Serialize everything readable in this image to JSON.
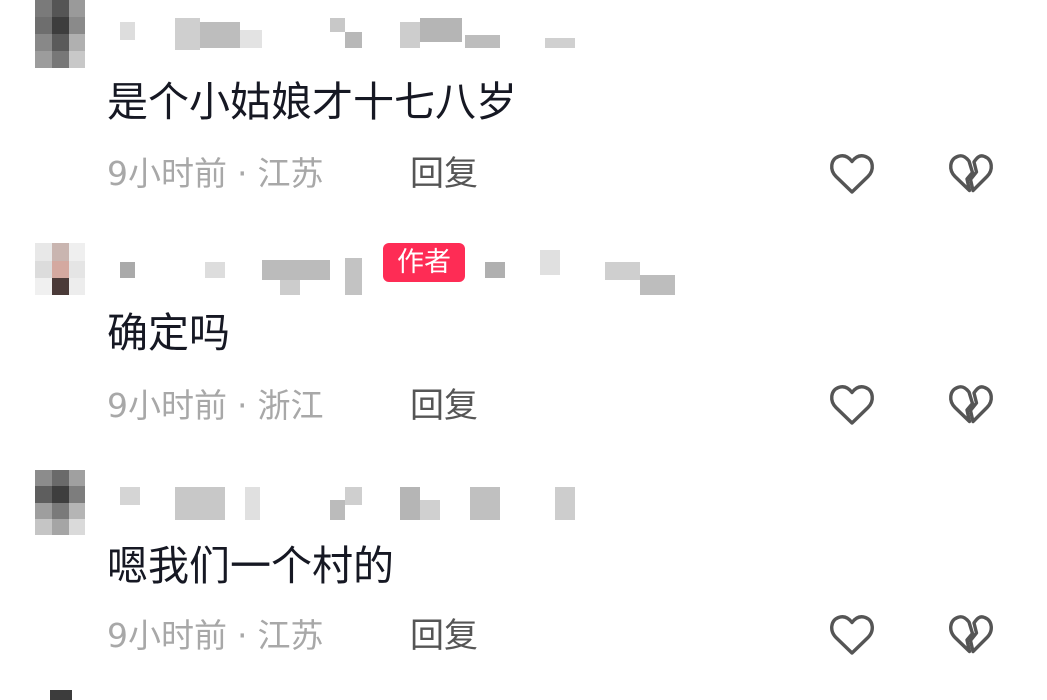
{
  "comments": [
    {
      "text": "是个小姑娘才十七八岁",
      "time": "9小时前",
      "separator": "·",
      "location": "江苏",
      "reply_label": "回复"
    },
    {
      "badge": "作者",
      "text": "确定吗",
      "time": "9小时前",
      "separator": "·",
      "location": "浙江",
      "reply_label": "回复"
    },
    {
      "text": "嗯我们一个村的",
      "time": "9小时前",
      "separator": "·",
      "location": "江苏",
      "reply_label": "回复"
    }
  ],
  "icons": {
    "like": "heart-outline-icon",
    "dislike": "broken-heart-icon"
  },
  "colors": {
    "text": "#161823",
    "meta": "#a8a8a8",
    "reply": "#555555",
    "badge_bg": "#fe2c55",
    "badge_text": "#ffffff",
    "icon": "#555555"
  }
}
